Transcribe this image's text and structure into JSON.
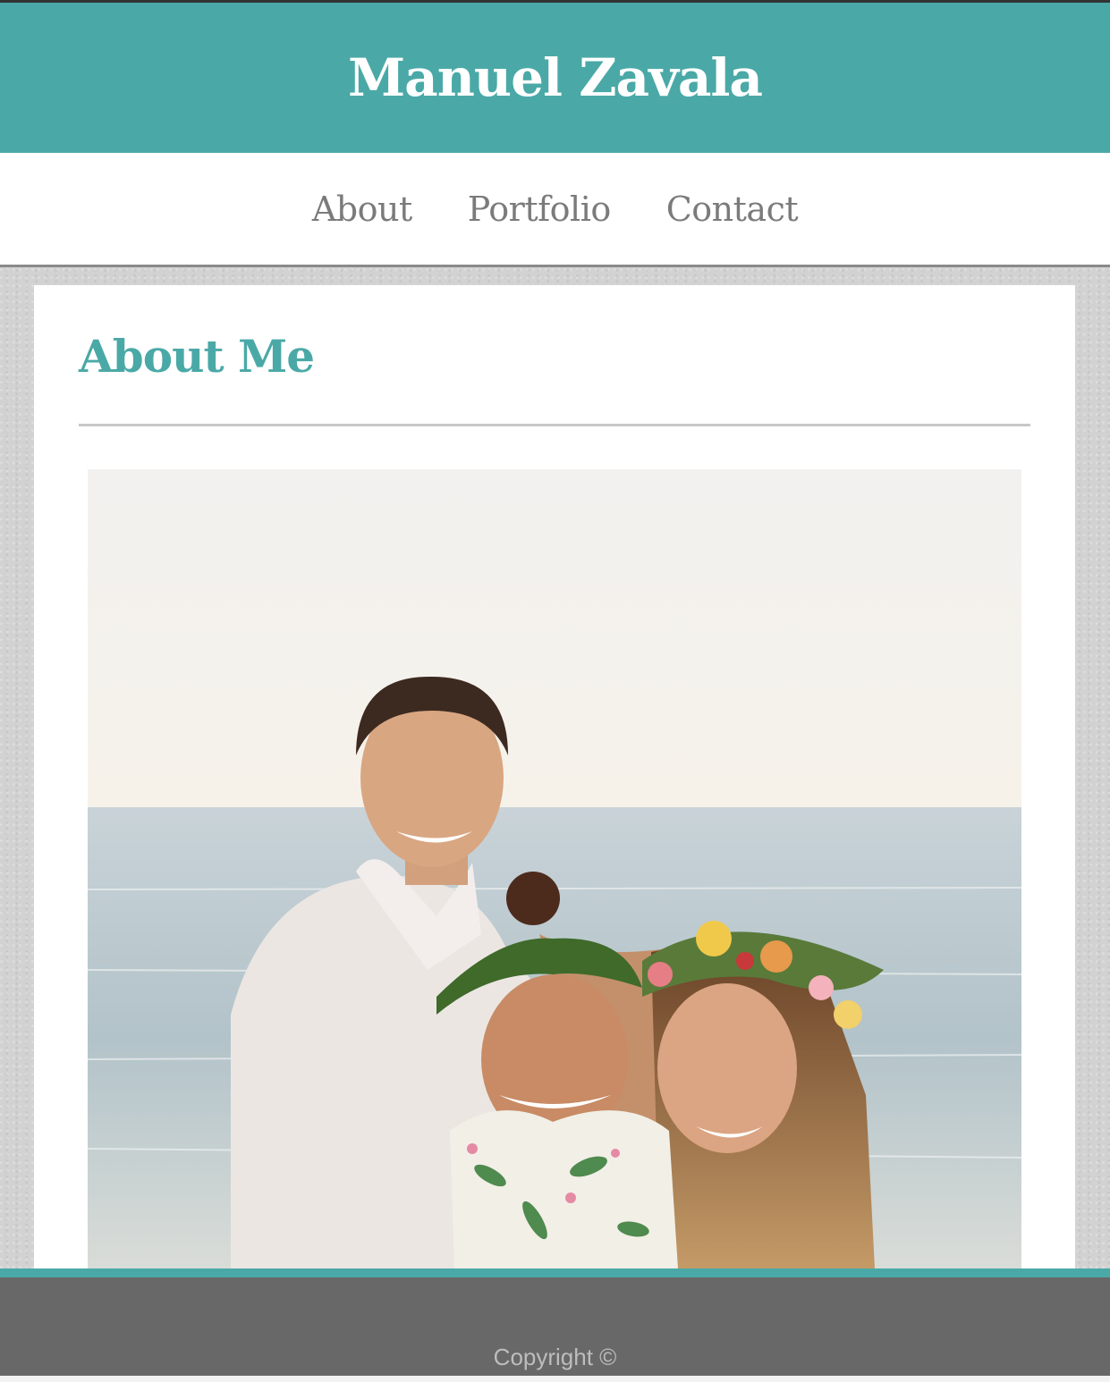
{
  "header": {
    "site_title": "Manuel Zavala"
  },
  "nav": {
    "items": [
      {
        "label": "About"
      },
      {
        "label": "Portfolio"
      },
      {
        "label": "Contact"
      }
    ]
  },
  "main": {
    "heading": "About Me"
  },
  "footer": {
    "copyright": "Copyright ©"
  },
  "colors": {
    "accent": "#4aa9a7",
    "nav_text": "#7b7b7b",
    "footer_bg": "#686868",
    "footer_text": "#bdbdbd",
    "page_bg": "#d2d2d2"
  }
}
